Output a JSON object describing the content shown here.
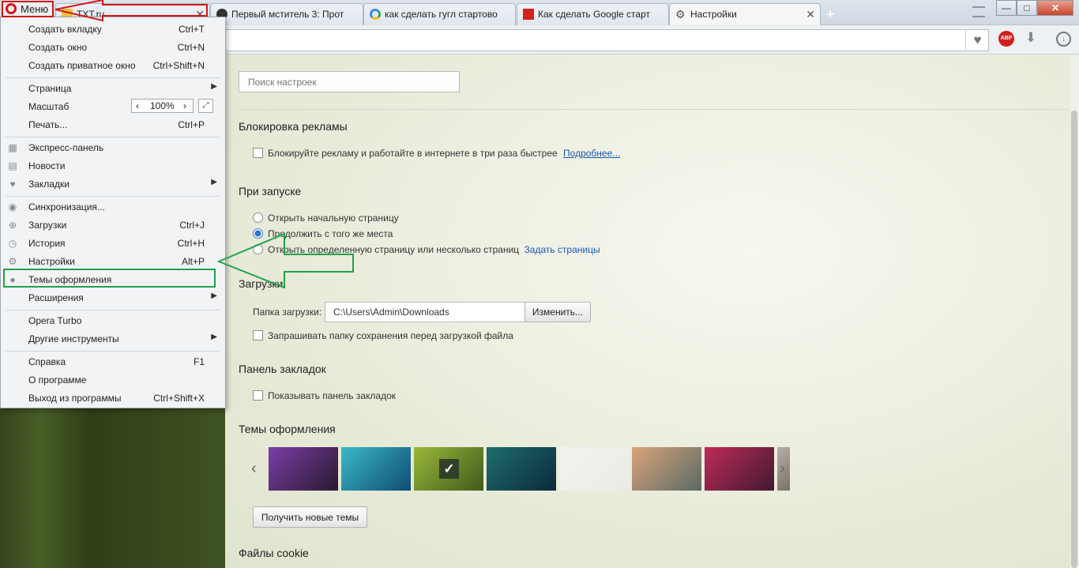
{
  "tabs": [
    {
      "title": "TXT.ru"
    },
    {
      "title": "Первый мститель 3: Прот"
    },
    {
      "title": "как сделать гугл стартово"
    },
    {
      "title": "Как сделать Google старт"
    },
    {
      "title": "Настройки"
    }
  ],
  "window": {
    "minimize": "—",
    "maximize": "□",
    "close": "✕"
  },
  "menu": {
    "button_label": "Меню",
    "items": [
      {
        "label": "Создать вкладку",
        "shortcut": "Ctrl+T"
      },
      {
        "label": "Создать окно",
        "shortcut": "Ctrl+N"
      },
      {
        "label": "Создать приватное окно",
        "shortcut": "Ctrl+Shift+N"
      },
      {
        "label": "Страница",
        "shortcut": ""
      },
      {
        "label": "Масштаб",
        "shortcut": ""
      },
      {
        "label": "Печать...",
        "shortcut": "Ctrl+P"
      },
      {
        "label": "Экспресс-панель",
        "shortcut": "",
        "icon": "grid-icon"
      },
      {
        "label": "Новости",
        "shortcut": "",
        "icon": "news-icon"
      },
      {
        "label": "Закладки",
        "shortcut": "",
        "icon": "heart-icon"
      },
      {
        "label": "Синхронизация...",
        "shortcut": "",
        "icon": "account-icon"
      },
      {
        "label": "Загрузки",
        "shortcut": "Ctrl+J",
        "icon": "download-icon"
      },
      {
        "label": "История",
        "shortcut": "Ctrl+H",
        "icon": "clock-icon"
      },
      {
        "label": "Настройки",
        "shortcut": "Alt+P",
        "icon": "gear-icon"
      },
      {
        "label": "Темы оформления",
        "shortcut": "",
        "icon": "drop-icon"
      },
      {
        "label": "Расширения",
        "shortcut": ""
      },
      {
        "label": "Opera Turbo",
        "shortcut": ""
      },
      {
        "label": "Другие инструменты",
        "shortcut": ""
      },
      {
        "label": "Справка",
        "shortcut": "F1"
      },
      {
        "label": "О программе",
        "shortcut": ""
      },
      {
        "label": "Выход из программы",
        "shortcut": "Ctrl+Shift+X"
      }
    ],
    "zoom": "100%"
  },
  "settings": {
    "search_placeholder": "Поиск настроек",
    "adblock": {
      "heading": "Блокировка рекламы",
      "checkbox_label": "Блокируйте рекламу и работайте в интернете в три раза быстрее",
      "more_link": "Подробнее..."
    },
    "startup": {
      "heading": "При запуске",
      "option1": "Открыть начальную страницу",
      "option2": "Продолжить с того же места",
      "option3": "Открыть определенную страницу или несколько страниц",
      "set_pages_link": "Задать страницы",
      "selected": 2
    },
    "downloads": {
      "heading": "Загрузки",
      "folder_label": "Папка загрузки:",
      "folder_value": "C:\\Users\\Admin\\Downloads",
      "change_button": "Изменить...",
      "ask_label": "Запрашивать папку сохранения перед загрузкой файла"
    },
    "bookmarks_bar": {
      "heading": "Панель закладок",
      "show_label": "Показывать панель закладок"
    },
    "themes": {
      "heading": "Темы оформления",
      "get_more_button": "Получить новые темы",
      "thumbs": [
        {
          "name": "concert",
          "colors": [
            "#7b3ea8",
            "#2a1a2e"
          ]
        },
        {
          "name": "aqua-wave",
          "colors": [
            "#3bb8c8",
            "#0f4c74"
          ]
        },
        {
          "name": "green-leaf",
          "colors": [
            "#9ab83a",
            "#3f5a1a"
          ]
        },
        {
          "name": "peacock",
          "colors": [
            "#1f6d6c",
            "#0b2b3a"
          ]
        },
        {
          "name": "plain-light",
          "colors": [
            "#f2f2f0",
            "#eaeae6"
          ]
        },
        {
          "name": "mountains",
          "colors": [
            "#d9a47c",
            "#5a6a64"
          ]
        },
        {
          "name": "red-abstract",
          "colors": [
            "#c02a5a",
            "#401a30"
          ]
        },
        {
          "name": "partial",
          "colors": [
            "#b8b0a8",
            "#7a7068"
          ]
        }
      ],
      "selected_index": 2
    },
    "cookies": {
      "heading": "Файлы cookie"
    }
  },
  "colors": {
    "opera_red": "#d21818",
    "highlight_green": "#22a04a",
    "link_blue": "#1a58b8"
  }
}
